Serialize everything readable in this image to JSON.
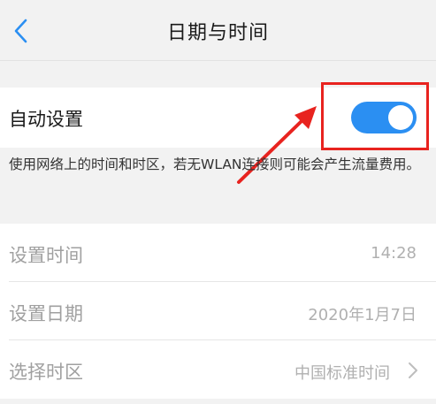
{
  "header": {
    "title": "日期与时间",
    "back_icon": "chevron-left-icon"
  },
  "auto_setting": {
    "label": "自动设置",
    "toggle_on": true,
    "description": "使用网络上的时间和时区，若无WLAN连接则可能会产生流量费用。"
  },
  "settings": [
    {
      "label": "设置时间",
      "value": "14:28"
    },
    {
      "label": "设置日期",
      "value": "2020年1月7日"
    },
    {
      "label": "选择时区",
      "value": "中国标准时间"
    }
  ],
  "colors": {
    "accent": "#2b8ff2",
    "annotation": "#e8231f"
  }
}
